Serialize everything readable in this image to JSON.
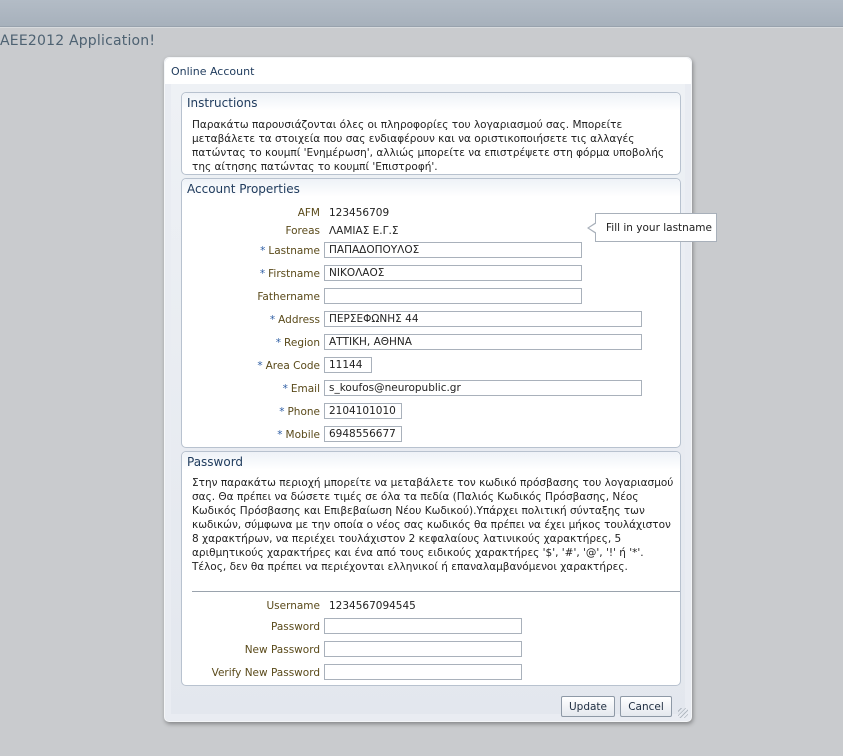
{
  "app": {
    "title": "AEE2012 Application!"
  },
  "window": {
    "title": "Online Account"
  },
  "instructions": {
    "title": "Instructions",
    "text": "Παρακάτω παρουσιάζονται όλες οι πληροφορίες του λογαριασμού σας. Μπορείτε μεταβάλετε τα στοιχεία που σας ενδιαφέρουν και να οριστικοποιήσετε τις αλλαγές πατώντας το κουμπί 'Ενημέρωση', αλλιώς μπορείτε να επιστρέψετε στη φόρμα υποβολής της αίτησης πατώντας το κουμπί 'Επιστροφή'."
  },
  "account": {
    "title": "Account Properties",
    "required_mark": "*",
    "afm": {
      "label": "AFM",
      "value": "123456709"
    },
    "foreas": {
      "label": "Foreas",
      "value": "ΛΑΜΙΑΣ Ε.Γ.Σ"
    },
    "lastname": {
      "label": "Lastname",
      "value": "ΠΑΠΑΔΟΠΟΥΛΟΣ"
    },
    "firstname": {
      "label": "Firstname",
      "value": "ΝΙΚΟΛΑΟΣ"
    },
    "fathername": {
      "label": "Fathername",
      "value": ""
    },
    "address": {
      "label": "Address",
      "value": "ΠΕΡΣΕΦΩΝΗΣ 44"
    },
    "region": {
      "label": "Region",
      "value": "ΑΤΤΙΚΗ, ΑΘΗΝΑ"
    },
    "area_code": {
      "label": "Area Code",
      "value": "11144"
    },
    "email": {
      "label": "Email",
      "value": "s_koufos@neuropublic.gr"
    },
    "phone": {
      "label": "Phone",
      "value": "2104101010"
    },
    "mobile": {
      "label": "Mobile",
      "value": "6948556677"
    }
  },
  "tooltip": {
    "text": "Fill in your lastname"
  },
  "password": {
    "title": "Password",
    "text": "Στην παρακάτω περιοχή μπορείτε να μεταβάλετε τον κωδικό πρόσβασης του λογαριασμού σας. Θα πρέπει να δώσετε τιμές σε όλα τα πεδία (Παλιός Κωδικός Πρόσβασης, Νέος Κωδικός Πρόσβασης και Επιβεβαίωση Νέου Κωδικού).Υπάρχει πολιτική σύνταξης των κωδικών, σύμφωνα με την οποία ο νέος σας κωδικός θα πρέπει να έχει μήκος τουλάχιστον 8 χαρακτήρων, να περιέχει τουλάχιστον 2 κεφαλαίους λατινικούς χαρακτήρες, 5 αριθμητικούς χαρακτήρες και ένα από τους ειδικούς χαρακτήρες '$', '#', '@', '!' ή '*'. Τέλος, δεν θα πρέπει να περιέχονται ελληνικοί ή επαναλαμβανόμενοι χαρακτήρες.",
    "username": {
      "label": "Username",
      "value": "1234567094545"
    },
    "current": {
      "label": "Password",
      "value": ""
    },
    "new": {
      "label": "New Password",
      "value": ""
    },
    "verify": {
      "label": "Verify New Password",
      "value": ""
    }
  },
  "buttons": {
    "update": "Update",
    "cancel": "Cancel"
  }
}
